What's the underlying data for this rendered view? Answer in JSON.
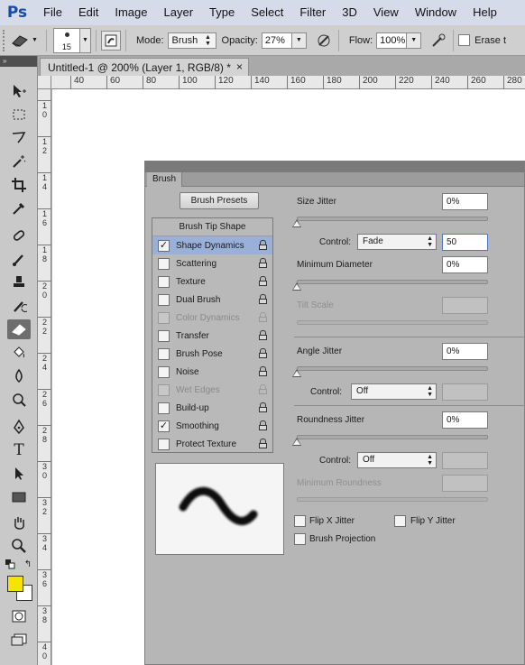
{
  "app": {
    "logo": "Ps",
    "menu": [
      "File",
      "Edit",
      "Image",
      "Layer",
      "Type",
      "Select",
      "Filter",
      "3D",
      "View",
      "Window",
      "Help"
    ]
  },
  "options_bar": {
    "brush_size": "15",
    "mode_label": "Mode:",
    "mode_value": "Brush",
    "opacity_label": "Opacity:",
    "opacity_value": "27%",
    "flow_label": "Flow:",
    "flow_value": "100%",
    "erase_label": "Erase t"
  },
  "document": {
    "tab_title": "Untitled-1 @ 200% (Layer 1, RGB/8) *",
    "close_glyph": "×",
    "h_ruler_ticks": [
      "40",
      "60",
      "80",
      "100",
      "120",
      "140",
      "160",
      "180",
      "200",
      "220",
      "240",
      "260",
      "280"
    ],
    "v_ruler_ticks": [
      "1\n0",
      "1\n2",
      "1\n4",
      "1\n6",
      "1\n8",
      "2\n0",
      "2\n2",
      "2\n4",
      "2\n6",
      "2\n8",
      "3\n0",
      "3\n2",
      "3\n4",
      "3\n6",
      "3\n8",
      "4\n0"
    ]
  },
  "toolbar": {
    "header": "»",
    "colors": {
      "foreground": "#f5e400",
      "background": "#ffffff"
    }
  },
  "brush_panel": {
    "tab": "Brush",
    "presets_button": "Brush Presets",
    "tip_shape": "Brush Tip Shape",
    "categories": [
      {
        "label": "Shape Dynamics",
        "checked": true,
        "selected": true,
        "disabled": false
      },
      {
        "label": "Scattering",
        "checked": false,
        "selected": false,
        "disabled": false
      },
      {
        "label": "Texture",
        "checked": false,
        "selected": false,
        "disabled": false
      },
      {
        "label": "Dual Brush",
        "checked": false,
        "selected": false,
        "disabled": false
      },
      {
        "label": "Color Dynamics",
        "checked": false,
        "selected": false,
        "disabled": true
      },
      {
        "label": "Transfer",
        "checked": false,
        "selected": false,
        "disabled": false
      },
      {
        "label": "Brush Pose",
        "checked": false,
        "selected": false,
        "disabled": false
      },
      {
        "label": "Noise",
        "checked": false,
        "selected": false,
        "disabled": false
      },
      {
        "label": "Wet Edges",
        "checked": false,
        "selected": false,
        "disabled": true
      },
      {
        "label": "Build-up",
        "checked": false,
        "selected": false,
        "disabled": false
      },
      {
        "label": "Smoothing",
        "checked": true,
        "selected": false,
        "disabled": false
      },
      {
        "label": "Protect Texture",
        "checked": false,
        "selected": false,
        "disabled": false
      }
    ],
    "size_jitter": {
      "label": "Size Jitter",
      "value": "0%"
    },
    "size_control": {
      "label": "Control:",
      "value": "Fade",
      "fade_steps": "50"
    },
    "min_diameter": {
      "label": "Minimum Diameter",
      "value": "0%"
    },
    "tilt_scale": {
      "label": "Tilt Scale"
    },
    "angle_jitter": {
      "label": "Angle Jitter",
      "value": "0%"
    },
    "angle_control": {
      "label": "Control:",
      "value": "Off"
    },
    "roundness_jitter": {
      "label": "Roundness Jitter",
      "value": "0%"
    },
    "roundness_control": {
      "label": "Control:",
      "value": "Off"
    },
    "min_roundness": {
      "label": "Minimum Roundness"
    },
    "flip_x": "Flip X Jitter",
    "flip_y": "Flip Y Jitter",
    "projection": "Brush Projection"
  }
}
